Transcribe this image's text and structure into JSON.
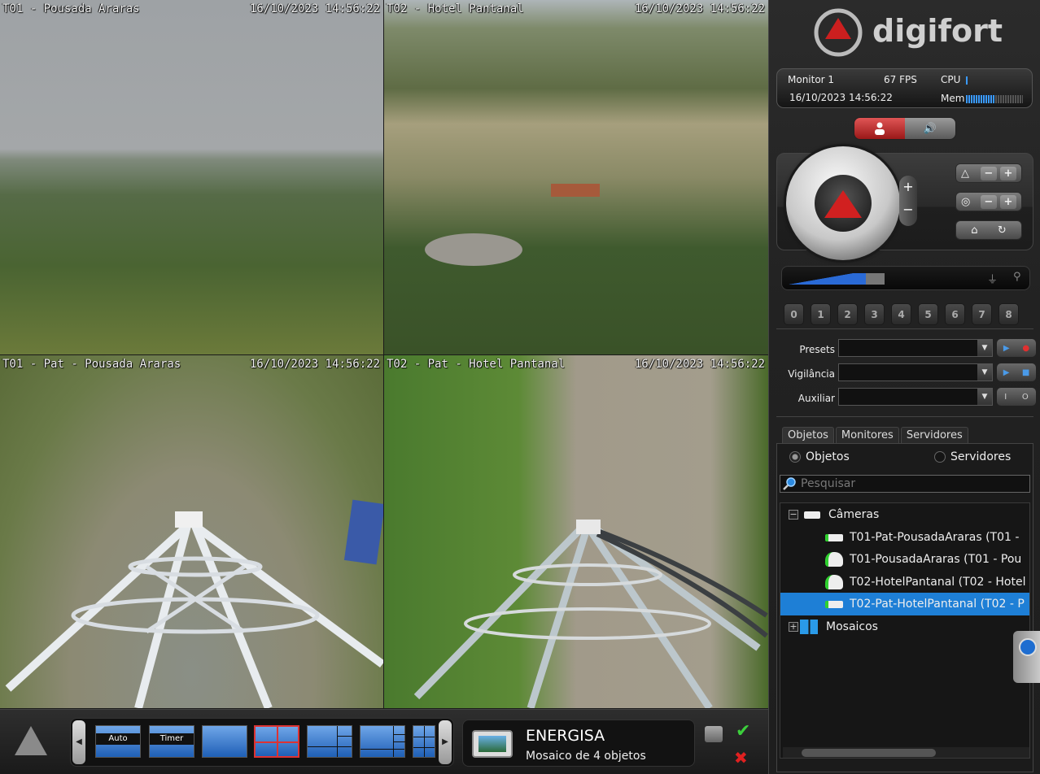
{
  "cameras": [
    {
      "name": "T01 - Pousada Araras",
      "timestamp": "16/10/2023 14:56:22"
    },
    {
      "name": "T02 - Hotel Pantanal",
      "timestamp": "16/10/2023 14:56:22"
    },
    {
      "name": "T01 - Pat - Pousada Araras",
      "timestamp": "16/10/2023 14:56:22"
    },
    {
      "name": "T02 - Pat - Hotel Pantanal",
      "timestamp": "16/10/2023 14:56:22"
    }
  ],
  "brand": {
    "name": "digifort",
    "accent": "#cc1f1f"
  },
  "status": {
    "monitor": "Monitor 1",
    "fps": "67 FPS",
    "cpu_label": "CPU",
    "datetime": "16/10/2023 14:56:22",
    "mem_label": "Mem",
    "cpu_level": 0.05,
    "mem_level": 0.5
  },
  "ptz": {
    "zoom_plus": "+",
    "zoom_minus": "−",
    "presets_numbers": [
      "0",
      "1",
      "2",
      "3",
      "4",
      "5",
      "6",
      "7",
      "8"
    ]
  },
  "form": {
    "presets_label": "Presets",
    "vigilancia_label": "Vigilância",
    "auxiliar_label": "Auxiliar"
  },
  "tabs": [
    "Objetos",
    "Monitores",
    "Servidores"
  ],
  "radios": {
    "objetos": "Objetos",
    "servidores": "Servidores"
  },
  "search": {
    "placeholder": "Pesquisar"
  },
  "tree": {
    "cameras_label": "Câmeras",
    "items": [
      "T01-Pat-PousadaAraras (T01 -",
      "T01-PousadaAraras (T01 - Pou",
      "T02-HotelPantanal (T02 - Hotel",
      "T02-Pat-HotelPantanal (T02 - P"
    ],
    "mosaics_label": "Mosaicos"
  },
  "bottom": {
    "auto_label": "Auto",
    "timer_label": "Timer",
    "client": "ENERGISA",
    "mosaic_desc": "Mosaico de 4 objetos"
  }
}
